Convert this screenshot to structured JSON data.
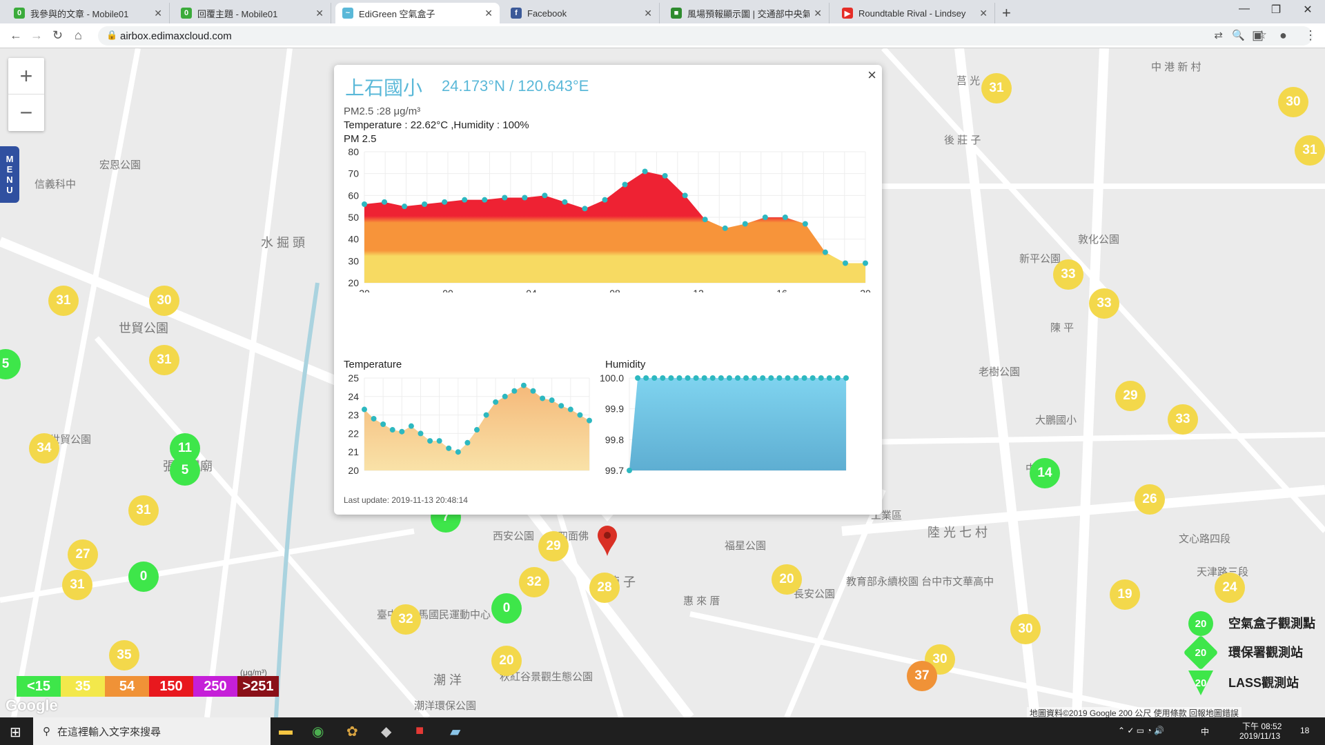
{
  "browser": {
    "tabs": [
      {
        "title": "我參與的文章 - Mobile01",
        "color": "#3bab3b",
        "glyph": "0"
      },
      {
        "title": "回覆主題 - Mobile01",
        "color": "#3bab3b",
        "glyph": "0"
      },
      {
        "title": "EdiGreen 空氣盒子",
        "color": "#5ab8d8",
        "glyph": "~"
      },
      {
        "title": "Facebook",
        "color": "#3b5998",
        "glyph": "f"
      },
      {
        "title": "風場預報顯示圖 | 交通部中央氣象",
        "color": "#2e8b2e",
        "glyph": "■"
      },
      {
        "title": "Roundtable Rival - Lindsey",
        "color": "#e52d27",
        "glyph": "▶"
      }
    ],
    "url": "airbox.edimaxcloud.com"
  },
  "popup": {
    "station": "上石國小",
    "coords": "24.173°N / 120.643°E",
    "pm_line": "PM2.5 :28 μg/m³",
    "temp_line": "Temperature : 22.62°C ,Humidity : 100%",
    "pm_title": "PM 2.5",
    "temp_title": "Temperature",
    "humidity_title": "Humidity",
    "last_update": "Last update: 2019-11-13 20:48:14",
    "close": "×"
  },
  "chart_data": [
    {
      "type": "area",
      "title": "PM 2.5",
      "x_ticks": [
        "20",
        "00",
        "04",
        "08",
        "12",
        "16",
        "20"
      ],
      "ylim": [
        20,
        80
      ],
      "y_ticks": [
        20,
        30,
        40,
        50,
        60,
        70,
        80
      ],
      "values": [
        56,
        57,
        55,
        56,
        57,
        58,
        58,
        59,
        59,
        60,
        57,
        54,
        58,
        65,
        71,
        69,
        60,
        49,
        45,
        47,
        50,
        50,
        47,
        34,
        29,
        29
      ],
      "grid": true
    },
    {
      "type": "area",
      "title": "Temperature",
      "ylim": [
        20,
        25
      ],
      "y_ticks": [
        20,
        21,
        22,
        23,
        24,
        25
      ],
      "values": [
        23.3,
        22.8,
        22.5,
        22.2,
        22.1,
        22.4,
        22.0,
        21.6,
        21.6,
        21.2,
        21.0,
        21.5,
        22.2,
        23.0,
        23.7,
        24.0,
        24.3,
        24.6,
        24.3,
        23.9,
        23.8,
        23.5,
        23.3,
        23.0,
        22.7
      ],
      "grid": true
    },
    {
      "type": "area",
      "title": "Humidity",
      "ylim": [
        99.7,
        100.0
      ],
      "y_ticks": [
        "99.7",
        "99.8",
        "99.9",
        "100.0"
      ],
      "values": [
        99.7,
        100,
        100,
        100,
        100,
        100,
        100,
        100,
        100,
        100,
        100,
        100,
        100,
        100,
        100,
        100,
        100,
        100,
        100,
        100,
        100,
        100,
        100,
        100,
        100,
        100,
        100
      ],
      "grid": true
    }
  ],
  "map": {
    "labels": [
      "水 掘 頭",
      "世貿公園",
      "張家祖廟",
      "湳 子",
      "惠 來 厝",
      "陳 平",
      "後 莊 子",
      "莒 光",
      "中 港 新 村",
      "敦化公園",
      "新平公園",
      "老樹公園",
      "大鵬國小",
      "福星公園",
      "長安公園",
      "陸 光 七 村",
      "潮 洋",
      "西安公園",
      "四面佛",
      "宏恩公園",
      "信義科中",
      "文心路四段",
      "天津路三段",
      "中平路",
      "臺中市朝馬國民運動中心",
      "秋紅谷景觀生態公園",
      "教育部永續校園 台中市文華高中",
      "潮洋環保公園",
      "工業區",
      "世貿公園"
    ],
    "markers": [
      {
        "v": "31",
        "c": "y"
      },
      {
        "v": "30",
        "c": "y"
      },
      {
        "v": "34",
        "c": "y"
      },
      {
        "v": "31",
        "c": "y"
      },
      {
        "v": "11",
        "c": "g"
      },
      {
        "v": "5",
        "c": "g"
      },
      {
        "v": "31",
        "c": "y"
      },
      {
        "v": "27",
        "c": "y"
      },
      {
        "v": "31",
        "c": "y"
      },
      {
        "v": "0",
        "c": "g"
      },
      {
        "v": "35",
        "c": "y"
      },
      {
        "v": "5",
        "c": "g"
      },
      {
        "v": "29",
        "c": "y"
      },
      {
        "v": "32",
        "c": "y"
      },
      {
        "v": "0",
        "c": "g"
      },
      {
        "v": "28",
        "c": "y"
      },
      {
        "v": "32",
        "c": "y"
      },
      {
        "v": "20",
        "c": "y"
      },
      {
        "v": "20",
        "c": "y"
      },
      {
        "v": "31",
        "c": "y"
      },
      {
        "v": "33",
        "c": "y"
      },
      {
        "v": "33",
        "c": "y"
      },
      {
        "v": "29",
        "c": "y"
      },
      {
        "v": "33",
        "c": "y"
      },
      {
        "v": "14",
        "c": "g"
      },
      {
        "v": "26",
        "c": "y"
      },
      {
        "v": "19",
        "c": "y"
      },
      {
        "v": "24",
        "c": "y"
      },
      {
        "v": "30",
        "c": "y"
      },
      {
        "v": "30",
        "c": "y"
      },
      {
        "v": "37",
        "c": "o"
      },
      {
        "v": "30",
        "c": "y"
      },
      {
        "v": "31",
        "c": "y"
      },
      {
        "v": "7",
        "c": "g"
      }
    ],
    "legend": [
      {
        "label": "<15",
        "color": "#3ee64a"
      },
      {
        "label": "35",
        "color": "#f3e84b"
      },
      {
        "label": "54",
        "color": "#f09237"
      },
      {
        "label": "150",
        "color": "#e8181e"
      },
      {
        "label": "250",
        "color": "#c51fd8"
      },
      {
        "label": ">251",
        "color": "#8a1018"
      }
    ],
    "legend_unit": "(μg/m³)",
    "station_legend": [
      {
        "label": "空氣盒子觀測點",
        "value": "20"
      },
      {
        "label": "環保署觀測站",
        "value": "20"
      },
      {
        "label": "LASS觀測站",
        "value": "20"
      }
    ],
    "footer": "地圖資料©2019 Google   200 公尺   使用條款   回報地圖錯誤",
    "zoom_in": "+",
    "zoom_out": "−",
    "menu": "MENU",
    "google": "Google"
  },
  "taskbar": {
    "search_placeholder": "在這裡輸入文字來搜尋",
    "time": "下午 08:52",
    "date": "2019/11/13",
    "ime": "中",
    "notif": "18"
  }
}
